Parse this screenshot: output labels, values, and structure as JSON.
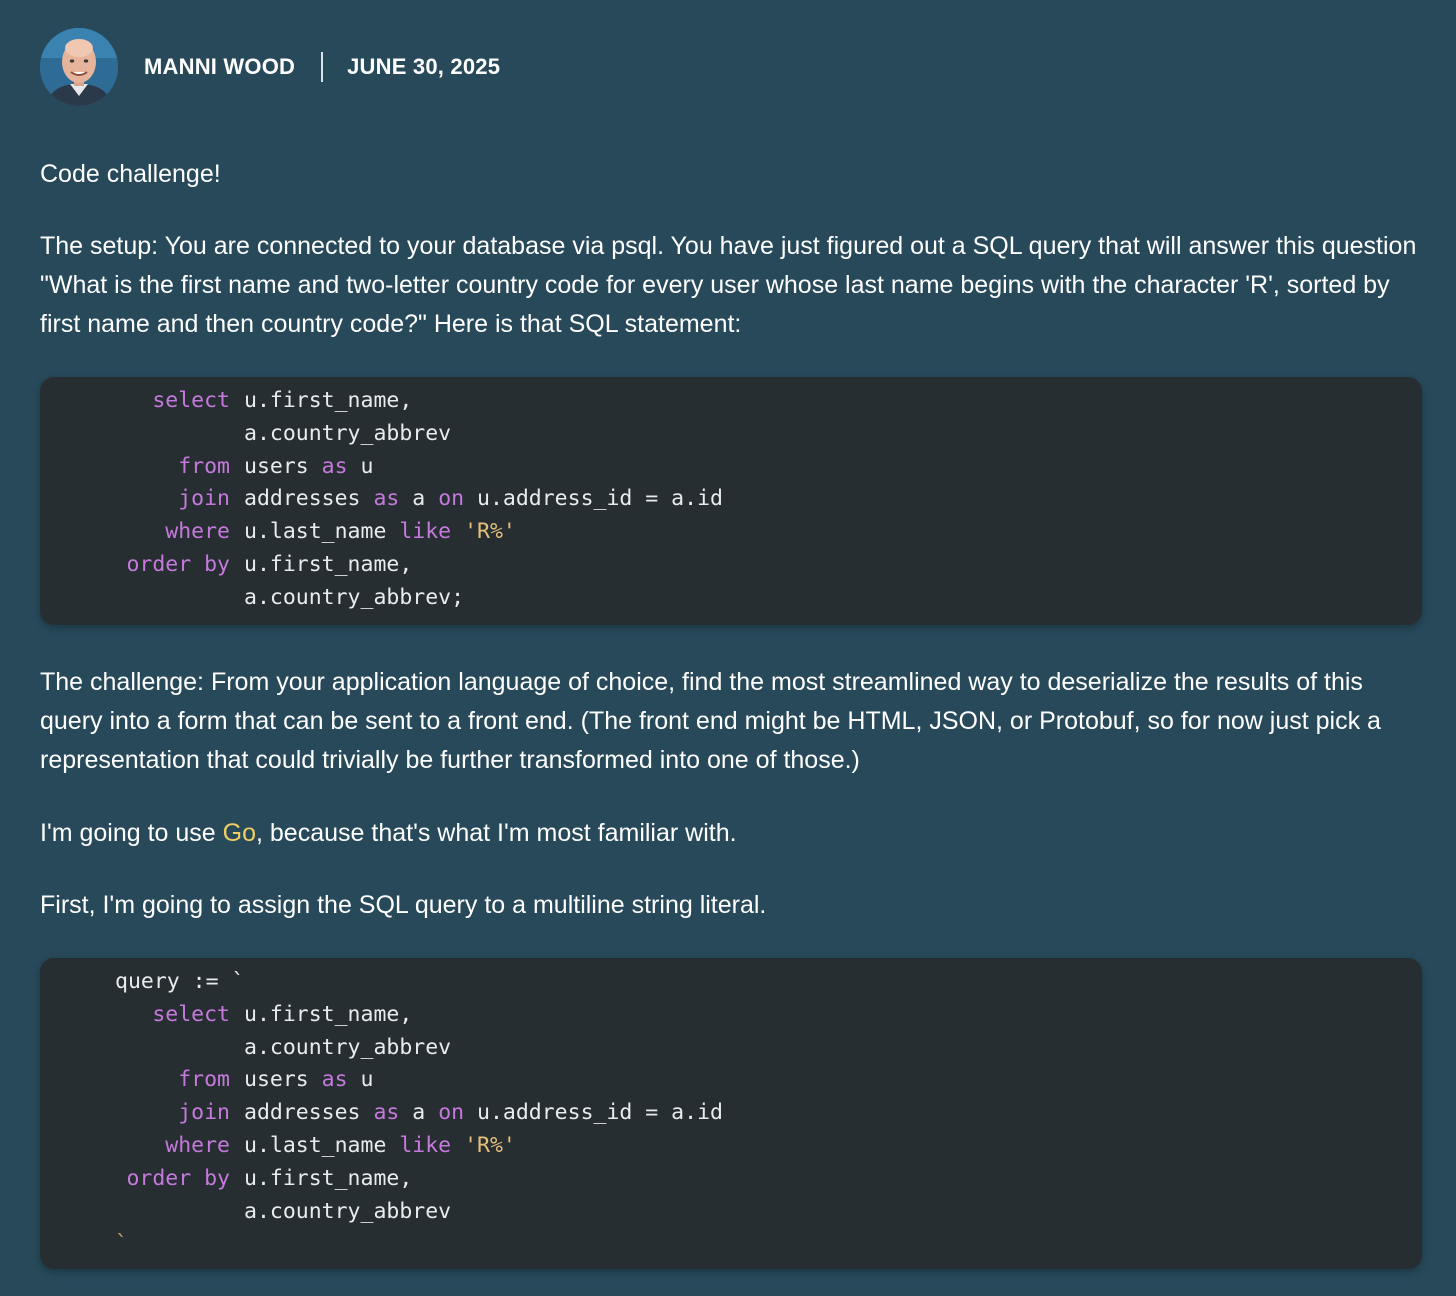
{
  "header": {
    "author": "MANNI WOOD",
    "date": "JUNE 30, 2025"
  },
  "paragraphs": {
    "intro": "Code challenge!",
    "setup": "The setup: You are connected to your database via psql. You have just figured out a SQL query that will answer this question \"What is the first name and two-letter country code for every user whose last name begins with the character 'R', sorted by first name and then country code?\" Here is that SQL statement:",
    "challenge": "The challenge: From your application language of choice, find the most streamlined way to deserialize the results of this query into a form that can be sent to a front end. (The front end might be HTML, JSON, or Protobuf, so for now just pick a representation that could trivially be further transformed into one of those.)",
    "go_before": "I'm going to use ",
    "go_link": "Go",
    "go_after": ", because that's what I'm most familiar with.",
    "first": "First, I'm going to assign the SQL query to a multiline string literal."
  },
  "code1": {
    "l1_kw": "select",
    "l1_rest": "u.first_name,",
    "l2_rest": "a.country_abbrev",
    "l3_kw": "from",
    "l3_a": "users ",
    "l3_k": "as",
    "l3_b": " u",
    "l4_kw": "join",
    "l4_a": "addresses ",
    "l4_k1": "as",
    "l4_b": " a ",
    "l4_k2": "on",
    "l4_c": " u.address_id = a.id",
    "l5_kw": "where",
    "l5_a": "u.last_name ",
    "l5_k": "like",
    "l5_sp": " ",
    "l5_s": "'R%'",
    "l6_kw": "order by",
    "l6_rest": "u.first_name,",
    "l7_rest": "a.country_abbrev;"
  },
  "code2": {
    "l0": "query := `",
    "l1_kw": "select",
    "l1_rest": "u.first_name,",
    "l2_rest": "a.country_abbrev",
    "l3_kw": "from",
    "l3_a": "users ",
    "l3_k": "as",
    "l3_b": " u",
    "l4_kw": "join",
    "l4_a": "addresses ",
    "l4_k1": "as",
    "l4_b": " a ",
    "l4_k2": "on",
    "l4_c": " u.address_id = a.id",
    "l5_kw": "where",
    "l5_a": "u.last_name ",
    "l5_k": "like",
    "l5_sp": " ",
    "l5_s": "'R%'",
    "l6_kw": "order by",
    "l6_rest": "u.first_name,",
    "l7_rest": "a.country_abbrev",
    "l8": "`"
  },
  "colors": {
    "background": "#27495a",
    "code_background": "#262e31",
    "keyword": "#c679dd",
    "string": "#e5c07b",
    "link": "#f0cd63"
  }
}
